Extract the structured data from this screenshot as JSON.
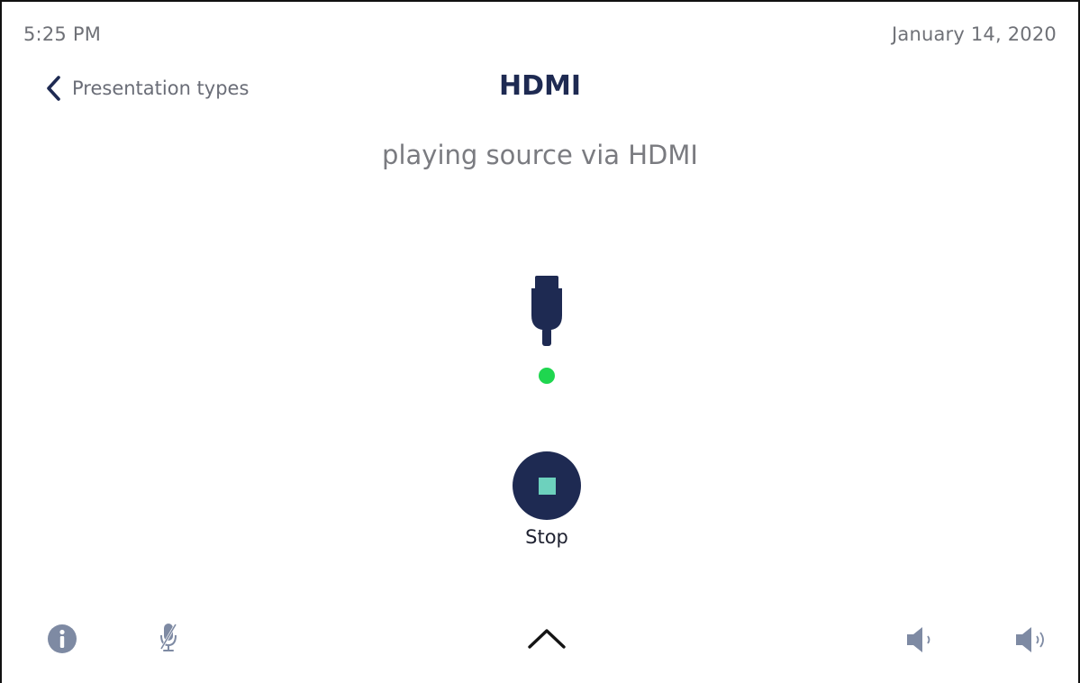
{
  "status_bar": {
    "time": "5:25 PM",
    "date": "January 14, 2020"
  },
  "nav": {
    "back_label": "Presentation types",
    "back_icon": "chevron-left-icon"
  },
  "header": {
    "title": "HDMI",
    "subtitle": "playing source via HDMI"
  },
  "source": {
    "icon": "hdmi-plug-icon",
    "status_color": "#1fd64f"
  },
  "stop": {
    "label": "Stop",
    "button_color": "#1e2a52",
    "square_color": "#6dd1bd"
  },
  "bottom_bar": {
    "icons": [
      "info-icon",
      "mic-muted-icon",
      "chevron-up-icon",
      "volume-down-icon",
      "volume-up-icon"
    ]
  },
  "colors": {
    "primary": "#1e2a52",
    "muted": "#7a7b80",
    "icon_gray": "#7e8aa3"
  }
}
